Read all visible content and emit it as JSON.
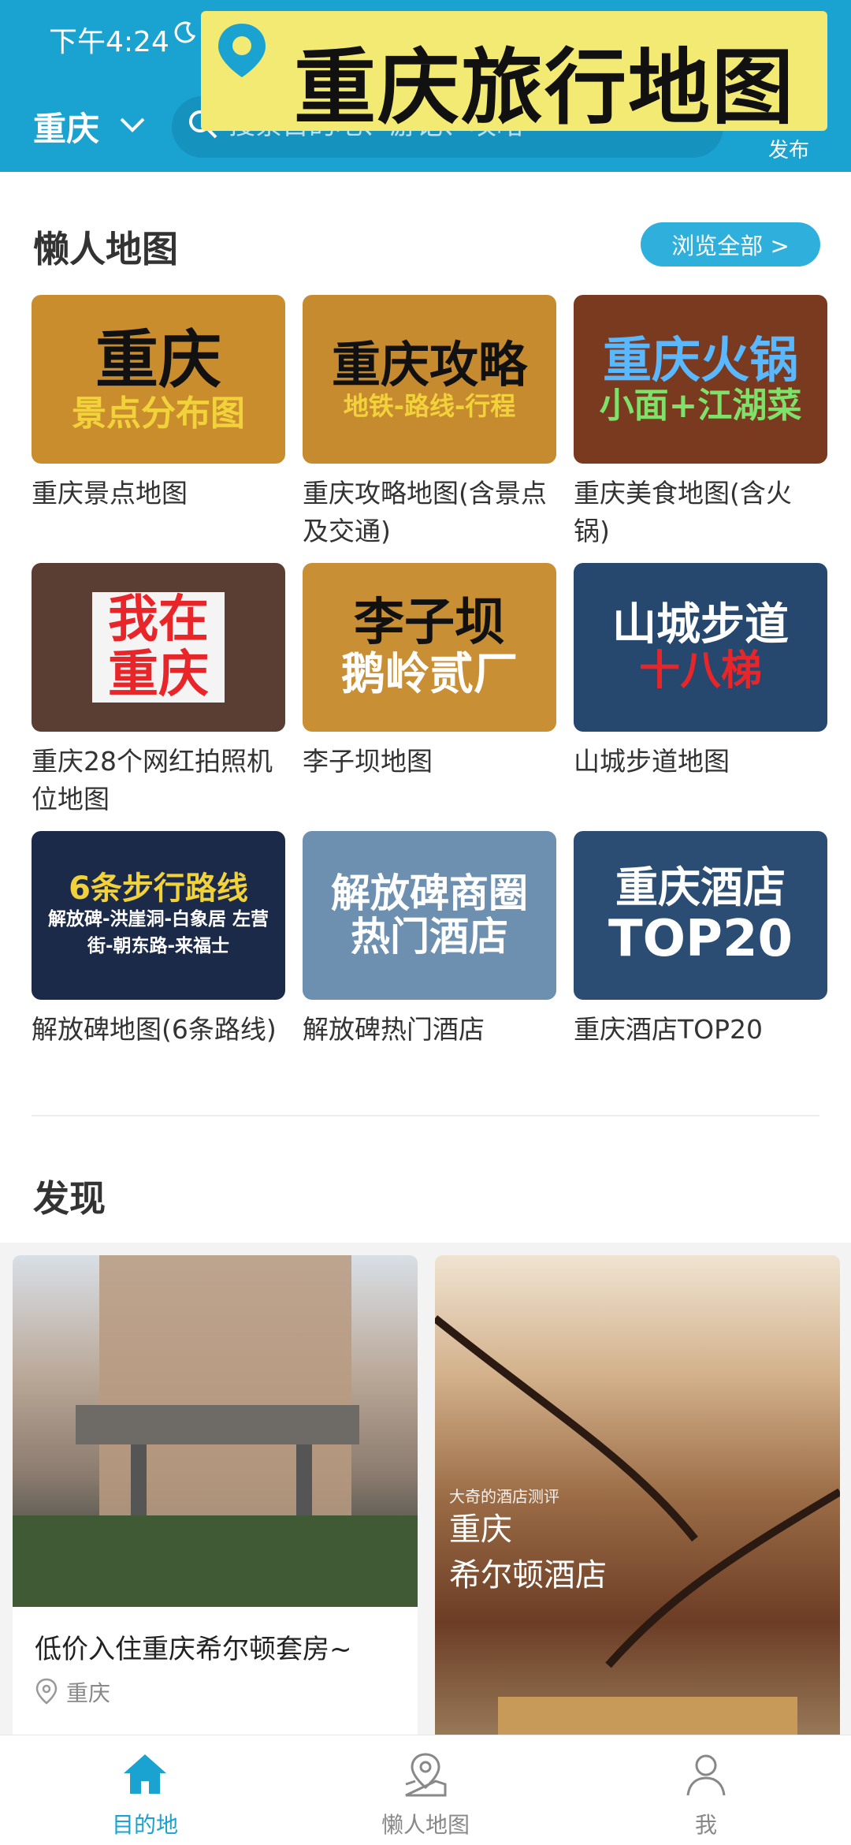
{
  "status_bar": {
    "time": "下午4:24"
  },
  "banner": {
    "title": "重庆旅行地图"
  },
  "header": {
    "city": "重庆",
    "search_placeholder": "搜索目的地、游记、攻略",
    "publish_label": "发布"
  },
  "lazy_maps": {
    "title": "懒人地图",
    "browse_all": "浏览全部 >",
    "cards": [
      {
        "thumb_line1": "重庆",
        "thumb_line2": "景点分布图",
        "title": "重庆景点地图",
        "bg": "#c98d2e",
        "line2_color": "#f2d23a"
      },
      {
        "thumb_line1": "重庆攻略",
        "thumb_line2": "地铁-路线-行程",
        "title": "重庆攻略地图(含景点及交通)",
        "bg": "#c78b2f",
        "line2_color": "#f2d23a"
      },
      {
        "thumb_line1": "重庆火锅",
        "thumb_line2": "小面+江湖菜",
        "title": "重庆美食地图(含火锅)",
        "bg": "#7a3a1f",
        "line2_color": "#7ee26a"
      },
      {
        "thumb_line1": "我在",
        "thumb_line2": "重庆",
        "title": "重庆28个网红拍照机位地图",
        "bg": "#5a3d33",
        "line2_color": "#e8262a"
      },
      {
        "thumb_line1": "李子坝",
        "thumb_line2": "鹅岭贰厂",
        "title": "李子坝地图",
        "bg": "#c98f35",
        "line2_color": "#ffffff"
      },
      {
        "thumb_line1": "山城步道",
        "thumb_line2": "十八梯",
        "title": "山城步道地图",
        "bg": "#26476e",
        "line2_color": "#e8262a"
      },
      {
        "thumb_line1": "6条步行路线",
        "thumb_line2": "解放碑-洪崖洞-白象居 左营街-朝东路-来福士",
        "title": "解放碑地图(6条路线)",
        "bg": "#1c2a4a",
        "line2_color": "#ffffff"
      },
      {
        "thumb_line1": "解放碑商圈",
        "thumb_line2": "热门酒店",
        "title": "解放碑热门酒店",
        "bg": "#6d8fb0",
        "line2_color": "#ffffff"
      },
      {
        "thumb_line1": "重庆酒店",
        "thumb_line2": "TOP20",
        "title": "重庆酒店TOP20",
        "bg": "#2b4c73",
        "line2_color": "#ffffff"
      }
    ]
  },
  "discover": {
    "title": "发现",
    "post1": {
      "caption": "低价入住重庆希尔顿套房~",
      "location": "重庆"
    },
    "post2": {
      "overlay_small": "大奇的酒店测评",
      "overlay_line1": "重庆",
      "overlay_line2": "希尔顿酒店"
    }
  },
  "tabbar": {
    "items": [
      {
        "label": "目的地"
      },
      {
        "label": "懒人地图"
      },
      {
        "label": "我"
      }
    ],
    "active_color": "#1aa3d1"
  }
}
